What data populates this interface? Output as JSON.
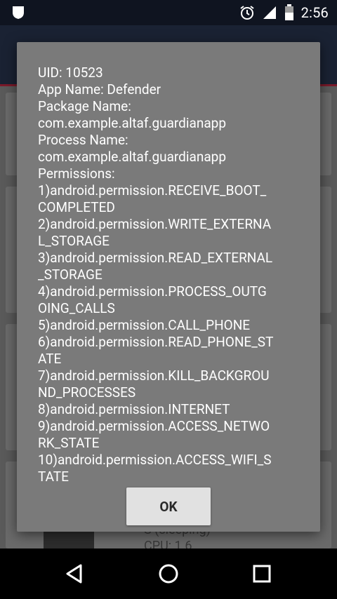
{
  "status_bar": {
    "time": "2:56",
    "icons": [
      "shield-icon",
      "alarm-icon",
      "signal-icon",
      "battery-icon"
    ]
  },
  "background_app": {
    "visible_text": [
      "S (sleeping)",
      "CPU:   1.6"
    ]
  },
  "dialog": {
    "lines": [
      "UID: 10523",
      "App Name: Defender",
      "Package Name:",
      "com.example.altaf.guardianapp",
      "Process Name:",
      "com.example.altaf.guardianapp",
      "Permissions:",
      "1)android.permission.RECEIVE_BOOT_",
      "COMPLETED",
      "2)android.permission.WRITE_EXTERNA",
      "L_STORAGE",
      "3)android.permission.READ_EXTERNAL",
      "_STORAGE",
      "4)android.permission.PROCESS_OUTG",
      "OING_CALLS",
      "5)android.permission.CALL_PHONE",
      "6)android.permission.READ_PHONE_ST",
      "ATE",
      "7)android.permission.KILL_BACKGROU",
      "ND_PROCESSES",
      "8)android.permission.INTERNET",
      "9)android.permission.ACCESS_NETWO",
      "RK_STATE",
      "10)android.permission.ACCESS_WIFI_S",
      "TATE"
    ],
    "ok_label": "OK"
  },
  "nav_bar": {
    "icons": [
      "back-icon",
      "home-icon",
      "recents-icon"
    ]
  },
  "colors": {
    "dialog_bg": "#7a7a7a",
    "ok_button_bg": "#e1e1e1",
    "status_bar_bg": "#0f1420"
  }
}
